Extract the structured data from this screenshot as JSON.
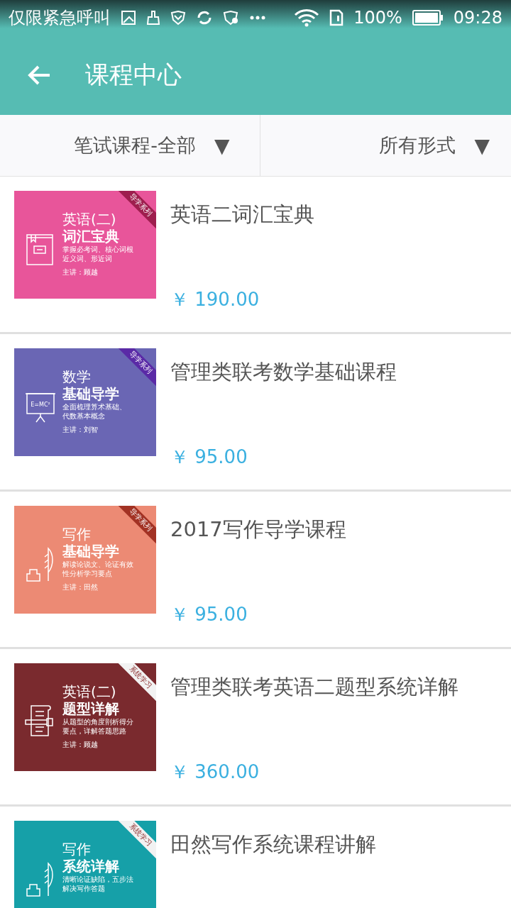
{
  "status_bar": {
    "carrier": "仅限紧急呼叫",
    "battery": "100%",
    "time": "09:28"
  },
  "toolbar": {
    "title": "课程中心"
  },
  "filters": [
    {
      "label": "笔试课程-全部",
      "arrow": "▼"
    },
    {
      "label": "所有形式",
      "arrow": "▼"
    }
  ],
  "courses": [
    {
      "title": "英语二词汇宝典",
      "price": "￥ 190.00",
      "cover": {
        "color": "#e8559a",
        "kind": "book",
        "ribbon": {
          "text": "导学系列",
          "color": "#9e1e4e",
          "kind": "dark"
        },
        "heading": "英语(二)",
        "subheading": "词汇宝典",
        "lines": [
          "掌握必考词、核心词根",
          "近义词、形近词"
        ],
        "teacher": "主讲：顾越"
      }
    },
    {
      "title": "管理类联考数学基础课程",
      "price": "￥ 95.00",
      "cover": {
        "color": "#6a66b4",
        "kind": "board",
        "board_text": "E=MC²",
        "ribbon": {
          "text": "导学系列",
          "color": "#5a2aa6",
          "kind": "dark"
        },
        "heading": "数学",
        "subheading": "基础导学",
        "lines": [
          "全面梳理算术基础、",
          "代数基本概念"
        ],
        "teacher": "主讲：刘智"
      }
    },
    {
      "title": "2017写作导学课程",
      "price": "￥ 95.00",
      "cover": {
        "color": "#ec8a74",
        "kind": "quill",
        "ribbon": {
          "text": "导学系列",
          "color": "#a23224",
          "kind": "dark"
        },
        "heading": "写作",
        "subheading": "基础导学",
        "lines": [
          "解读论说文、论证有效",
          "性分析学习要点"
        ],
        "teacher": "主讲：田然"
      }
    },
    {
      "title": "管理类联考英语二题型系统详解",
      "price": "￥ 360.00",
      "cover": {
        "color": "#7a2a2e",
        "kind": "scroll",
        "ribbon": {
          "text": "系统学习",
          "color": "#f2f2f2",
          "kind": "light"
        },
        "heading": "英语(二)",
        "subheading": "题型详解",
        "lines": [
          "从题型的角度剖析得分",
          "要点，详解答题思路"
        ],
        "teacher": "主讲：顾越"
      }
    },
    {
      "title": "田然写作系统课程讲解",
      "cover": {
        "color": "#16a0a8",
        "kind": "quill",
        "ribbon": {
          "text": "系统学习",
          "color": "#f2f2f2",
          "kind": "light"
        },
        "heading": "写作",
        "subheading": "系统详解",
        "lines": [
          "清晰论证缺陷，五步法",
          "解决写作答题"
        ]
      }
    }
  ]
}
